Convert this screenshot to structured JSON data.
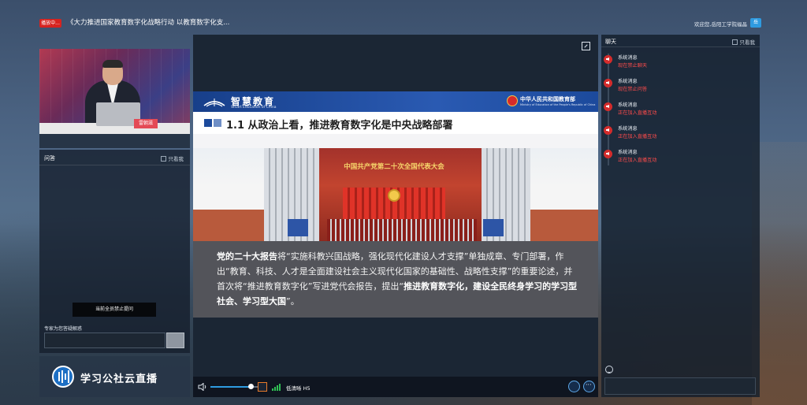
{
  "header": {
    "live_badge": "播放中...",
    "title": "《大力推进国家教育数字化战略行动 以教育数字化支...",
    "welcome": "欢迎您,岳阳工学院福晶",
    "user_avatar": "岳"
  },
  "teacher_video": {
    "name_plate": "雷朝滋"
  },
  "qa": {
    "title": "问答",
    "only_mine": "只看我",
    "ban_notice": "当前全员禁止提问",
    "expert_note": "专家为您答疑解惑"
  },
  "brand": {
    "name": "学习公社云直播"
  },
  "slide": {
    "logo_cn": "智慧教育",
    "logo_en": "Smart Education of China",
    "ministry_cn": "中华人民共和国教育部",
    "ministry_en": "Ministry of Education of the People's Republic of China",
    "heading": "1.1 从政治上看，推进教育数字化是中央战略部署",
    "hall_banner": "中国共产党第二十次全国代表大会",
    "body_bold_1": "党的二十大报告",
    "body_text": "将“实施科教兴国战略，强化现代化建设人才支撑”单独成章、专门部署，作出“教育、科技、人才是全面建设社会主义现代化国家的基础性、战略性支撑”的重要论述，并首次将“推进教育数字化”写进党代会报告，提出“",
    "body_bold_2": "推进教育数字化，建设全民终身学习的学习型社会、学习型大国",
    "body_end": "”。"
  },
  "player": {
    "volume_level": 0.85,
    "quality": "低清晰 H5"
  },
  "chat": {
    "title": "聊天",
    "only_mine": "只看我",
    "messages": [
      {
        "sender": "系统消息",
        "text": "现在禁止聊天"
      },
      {
        "sender": "系统消息",
        "text": "现在禁止问答"
      },
      {
        "sender": "系统消息",
        "text": "正在加入直播互动"
      },
      {
        "sender": "系统消息",
        "text": "正在加入直播互动"
      },
      {
        "sender": "系统消息",
        "text": "正在加入直播互动"
      }
    ]
  },
  "colors": {
    "live_red": "#d6231f",
    "system_msg_red": "#ff4b4b",
    "accent_blue": "#2f9be0"
  }
}
